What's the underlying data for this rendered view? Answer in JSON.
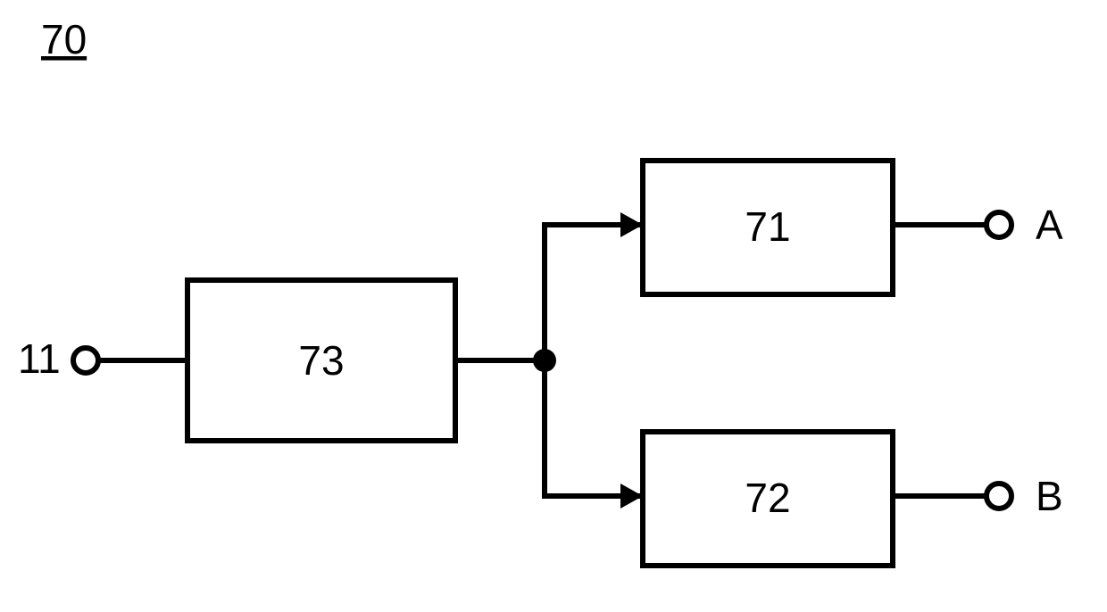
{
  "figure": {
    "number": "70",
    "input_label": "11",
    "blocks": {
      "pre": "73",
      "top": "71",
      "bottom": "72"
    },
    "outputs": {
      "top": "A",
      "bottom": "B"
    }
  }
}
